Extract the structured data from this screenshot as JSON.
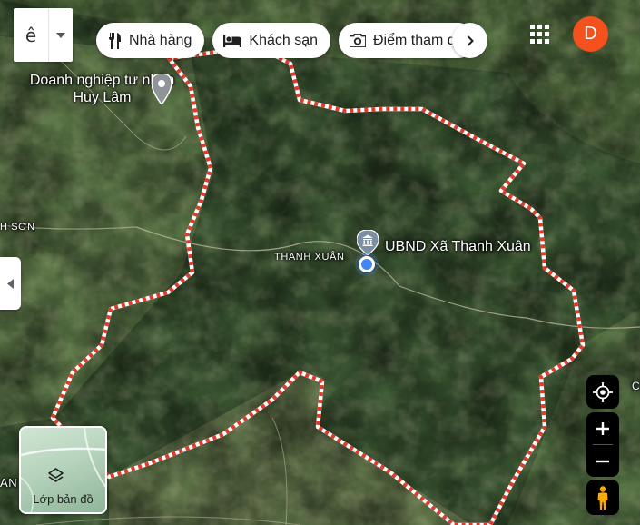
{
  "map": {
    "view": "satellite",
    "boundary_color": "#e23a2b",
    "labels": {
      "business": "Doanh nghiệp tư nhân Huy Lâm",
      "commune": "THANH XUÂN",
      "ubnd": "UBND Xã Thanh Xuân",
      "west_edge": "H SƠN",
      "southwest_edge": "AN",
      "east_edge": "C"
    }
  },
  "toolbar": {
    "input_tools_glyph": "ê",
    "chips": [
      {
        "label": "Nhà hàng",
        "icon": "restaurant-icon"
      },
      {
        "label": "Khách sạn",
        "icon": "hotel-icon"
      },
      {
        "label": "Điểm tham quan",
        "icon": "camera-icon"
      }
    ]
  },
  "account": {
    "initial": "D",
    "color": "#f4511e"
  },
  "layers": {
    "label": "Lớp bản đồ"
  },
  "colors": {
    "accent": "#4285f4",
    "control_bg": "#000000",
    "pegman": "#f9ab00"
  }
}
